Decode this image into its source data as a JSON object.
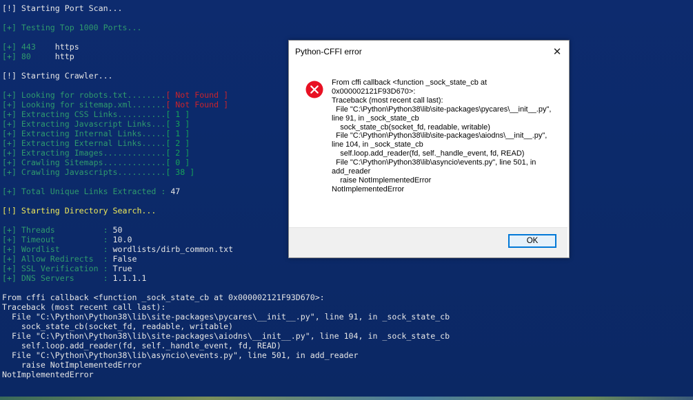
{
  "terminal": {
    "scan_header": "[!] Starting Port Scan...",
    "top_ports": "[+] Testing Top 1000 Ports...",
    "ports": [
      {
        "prefix": "[+] 443",
        "service": "https"
      },
      {
        "prefix": "[+] 80 ",
        "service": "http"
      }
    ],
    "crawler_header": "[!] Starting Crawler...",
    "crawler_lines": [
      {
        "label": "[+] Looking for robots.txt........",
        "value": "[ Not Found ]",
        "color": "red"
      },
      {
        "label": "[+] Looking for sitemap.xml.......",
        "value": "[ Not Found ]",
        "color": "red"
      },
      {
        "label": "[+] Extracting CSS Links..........",
        "value": "[ 1 ]",
        "color": "green"
      },
      {
        "label": "[+] Extracting Javascript Links...",
        "value": "[ 3 ]",
        "color": "green"
      },
      {
        "label": "[+] Extracting Internal Links.....",
        "value": "[ 1 ]",
        "color": "green"
      },
      {
        "label": "[+] Extracting External Links.....",
        "value": "[ 2 ]",
        "color": "green"
      },
      {
        "label": "[+] Extracting Images.............",
        "value": "[ 2 ]",
        "color": "green"
      },
      {
        "label": "[+] Crawling Sitemaps.............",
        "value": "[ 0 ]",
        "color": "green"
      },
      {
        "label": "[+] Crawling Javascripts..........",
        "value": "[ 38 ]",
        "color": "green"
      }
    ],
    "total_links_label": "[+] Total Unique Links Extracted :",
    "total_links_value": "47",
    "dir_header": "[!] Starting Directory Search...",
    "dir_settings": [
      {
        "label": "[+] Threads          :",
        "value": "50"
      },
      {
        "label": "[+] Timeout          :",
        "value": "10.0"
      },
      {
        "label": "[+] Wordlist         :",
        "value": "wordlists/dirb_common.txt"
      },
      {
        "label": "[+] Allow Redirects  :",
        "value": "False"
      },
      {
        "label": "[+] SSL Verification :",
        "value": "True"
      },
      {
        "label": "[+] DNS Servers      :",
        "value": "1.1.1.1"
      }
    ],
    "traceback": [
      "From cffi callback <function _sock_state_cb at 0x000002121F93D670>:",
      "Traceback (most recent call last):",
      "  File \"C:\\Python\\Python38\\lib\\site-packages\\pycares\\__init__.py\", line 91, in _sock_state_cb",
      "    sock_state_cb(socket_fd, readable, writable)",
      "  File \"C:\\Python\\Python38\\lib\\site-packages\\aiodns\\__init__.py\", line 104, in _sock_state_cb",
      "    self.loop.add_reader(fd, self._handle_event, fd, READ)",
      "  File \"C:\\Python\\Python38\\lib\\asyncio\\events.py\", line 501, in add_reader",
      "    raise NotImplementedError",
      "NotImplementedError"
    ]
  },
  "dialog": {
    "title": "Python-CFFI error",
    "close_glyph": "✕",
    "message_lines": [
      "From cffi callback <function _sock_state_cb at 0x000002121F93D670>:",
      "Traceback (most recent call last):",
      "  File \"C:\\Python\\Python38\\lib\\site-packages\\pycares\\__init__.py\", line 91, in _sock_state_cb",
      "    sock_state_cb(socket_fd, readable, writable)",
      "  File \"C:\\Python\\Python38\\lib\\site-packages\\aiodns\\__init__.py\", line 104, in _sock_state_cb",
      "    self.loop.add_reader(fd, self._handle_event, fd, READ)",
      "  File \"C:\\Python\\Python38\\lib\\asyncio\\events.py\", line 501, in add_reader",
      "    raise NotImplementedError",
      "NotImplementedError"
    ],
    "ok_label": "OK",
    "icon": "error-icon"
  },
  "colors": {
    "background": "#0c2a6b",
    "green": "#16a25a",
    "red": "#c8232c",
    "yellow": "#f0ea5a",
    "error_icon": "#e81123",
    "button_border": "#0078d7"
  }
}
